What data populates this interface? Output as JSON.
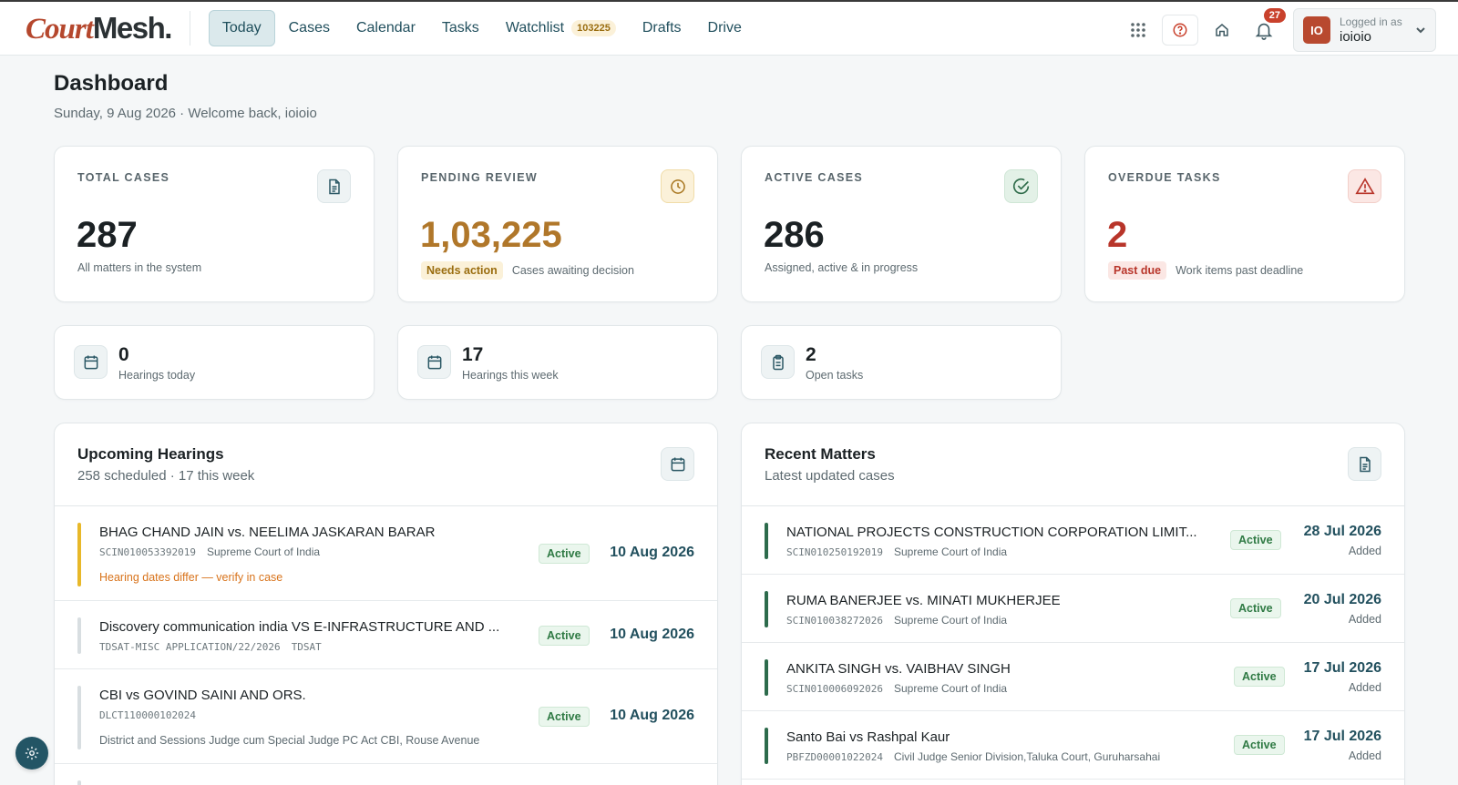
{
  "brand": {
    "logo_court": "Court",
    "logo_mesh": "Mesh."
  },
  "nav": {
    "today": "Today",
    "cases": "Cases",
    "calendar": "Calendar",
    "tasks": "Tasks",
    "watchlist": "Watchlist",
    "watchlist_count": "103225",
    "drafts": "Drafts",
    "drive": "Drive"
  },
  "topbar": {
    "notifications_count": "27",
    "logged_in_label": "Logged in as",
    "username": "ioioio",
    "avatar_initials": "IO"
  },
  "page": {
    "title": "Dashboard",
    "subtitle": "Sunday, 9 Aug 2026 · Welcome back, ioioio"
  },
  "stats": [
    {
      "label": "TOTAL CASES",
      "value": "287",
      "pill": "",
      "note": "All matters in the system",
      "value_color": "#1b2124",
      "icon": "document-icon"
    },
    {
      "label": "PENDING REVIEW",
      "value": "1,03,225",
      "pill": "Needs action",
      "note": "Cases awaiting decision",
      "value_color": "#b0772a",
      "icon": "clock-icon"
    },
    {
      "label": "ACTIVE CASES",
      "value": "286",
      "pill": "",
      "note": "Assigned, active & in progress",
      "value_color": "#1b2124",
      "icon": "check-circle-icon"
    },
    {
      "label": "OVERDUE TASKS",
      "value": "2",
      "pill": "Past due",
      "note": "Work items past deadline",
      "value_color": "#b8352a",
      "icon": "warning-triangle-icon"
    }
  ],
  "mini_stats": [
    {
      "value": "0",
      "label": "Hearings today",
      "icon": "calendar-icon"
    },
    {
      "value": "17",
      "label": "Hearings this week",
      "icon": "calendar-icon"
    },
    {
      "value": "2",
      "label": "Open tasks",
      "icon": "clipboard-icon"
    }
  ],
  "hearings": {
    "title": "Upcoming Hearings",
    "subtitle": "258 scheduled · 17 this week",
    "rows": [
      {
        "title": "BHAG CHAND JAIN vs. NEELIMA JASKARAN BARAR",
        "code": "SCIN010053392019",
        "court": "Supreme Court of India",
        "warning": "Hearing dates differ — verify in case",
        "status": "Active",
        "date": "10 Aug 2026"
      },
      {
        "title": "Discovery communication india VS E-INFRASTRUCTURE AND ...",
        "code": "TDSAT-MISC APPLICATION/22/2026",
        "court": "TDSAT",
        "status": "Active",
        "date": "10 Aug 2026"
      },
      {
        "title": "CBI vs GOVIND SAINI AND ORS.",
        "code": "DLCT110000102024",
        "court": "",
        "extra": "District and Sessions Judge cum Special Judge PC Act CBI, Rouse Avenue",
        "status": "Active",
        "date": "10 Aug 2026"
      }
    ]
  },
  "matters": {
    "title": "Recent Matters",
    "subtitle": "Latest updated cases",
    "rows": [
      {
        "title": "NATIONAL PROJECTS CONSTRUCTION CORPORATION LIMIT...",
        "code": "SCIN010250192019",
        "court": "Supreme Court of India",
        "status": "Active",
        "date": "28 Jul 2026",
        "added": "Added"
      },
      {
        "title": "RUMA BANERJEE vs. MINATI MUKHERJEE",
        "code": "SCIN010038272026",
        "court": "Supreme Court of India",
        "status": "Active",
        "date": "20 Jul 2026",
        "added": "Added"
      },
      {
        "title": "ANKITA SINGH vs. VAIBHAV SINGH",
        "code": "SCIN010006092026",
        "court": "Supreme Court of India",
        "status": "Active",
        "date": "17 Jul 2026",
        "added": "Added"
      },
      {
        "title": "Santo Bai vs Rashpal Kaur",
        "code": "PBFZD00001022024",
        "court": "Civil Judge Senior Division,Taluka Court, Guruharsahai",
        "status": "Active",
        "date": "17 Jul 2026",
        "added": "Added"
      }
    ]
  },
  "colors": {
    "accent": "#22505e",
    "brand_red": "#b5472d",
    "active_green": "#2f7a44",
    "warning_amber": "#e8b829",
    "danger": "#b8352a"
  }
}
